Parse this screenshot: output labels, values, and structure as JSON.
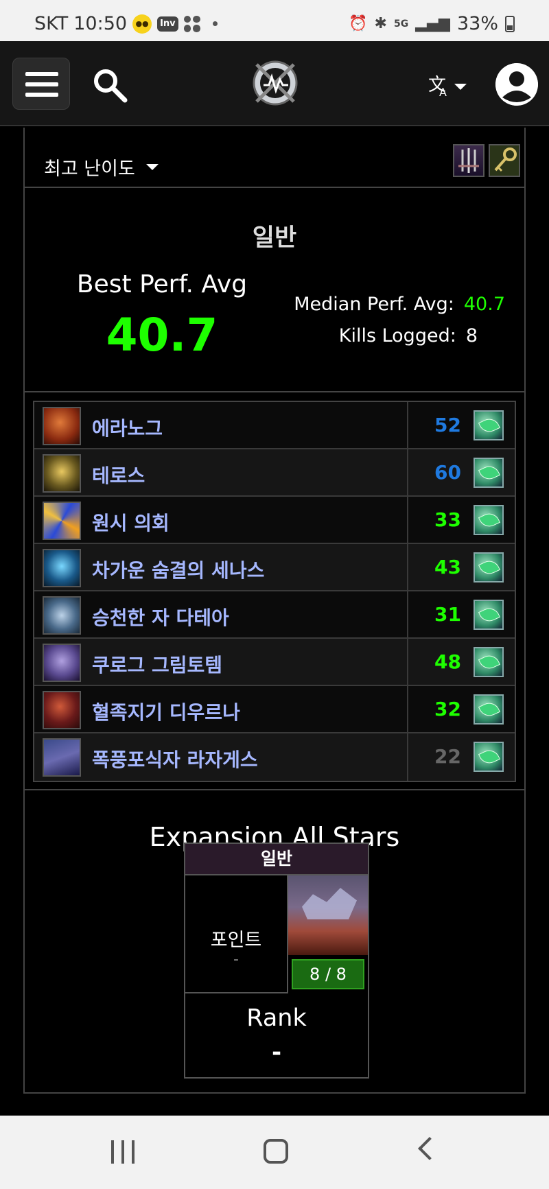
{
  "status_bar": {
    "carrier": "SKT",
    "time": "10:50",
    "notification_badges": [
      "KakaoTalk",
      "Inven"
    ],
    "battery": "33%",
    "icons": [
      "alarm-icon",
      "bluetooth-icon",
      "5g-icon",
      "signal-icon",
      "battery-icon"
    ]
  },
  "header": {
    "icons": [
      "menu-icon",
      "search-icon",
      "site-logo",
      "translate-icon",
      "account-icon"
    ]
  },
  "filter": {
    "difficulty_label": "최고 난이도"
  },
  "summary": {
    "difficulty": "일반",
    "best_perf_label": "Best Perf. Avg",
    "best_perf_value": "40.7",
    "median_label": "Median Perf. Avg:",
    "median_value": "40.7",
    "kills_label": "Kills Logged:",
    "kills_value": "8"
  },
  "bosses": [
    {
      "name": "에라노그",
      "score": "52",
      "color": "#1f7ae0"
    },
    {
      "name": "테로스",
      "score": "60",
      "color": "#1f7ae0"
    },
    {
      "name": "원시 의회",
      "score": "33",
      "color": "#1eff00"
    },
    {
      "name": "차가운 숨결의 세나스",
      "score": "43",
      "color": "#1eff00"
    },
    {
      "name": "승천한 자 다테아",
      "score": "31",
      "color": "#1eff00"
    },
    {
      "name": "쿠로그 그림토템",
      "score": "48",
      "color": "#1eff00"
    },
    {
      "name": "혈족지기 디우르나",
      "score": "32",
      "color": "#1eff00"
    },
    {
      "name": "폭풍포식자 라자게스",
      "score": "22",
      "color": "#666666"
    }
  ],
  "all_stars": {
    "title": "Expansion All Stars",
    "difficulty": "일반",
    "points_label": "포인트",
    "points_value": "-",
    "kills": "8 / 8",
    "rank_label": "Rank",
    "rank_value": "-"
  },
  "nav": {
    "icons": [
      "recent-apps-icon",
      "home-icon",
      "back-icon"
    ]
  }
}
